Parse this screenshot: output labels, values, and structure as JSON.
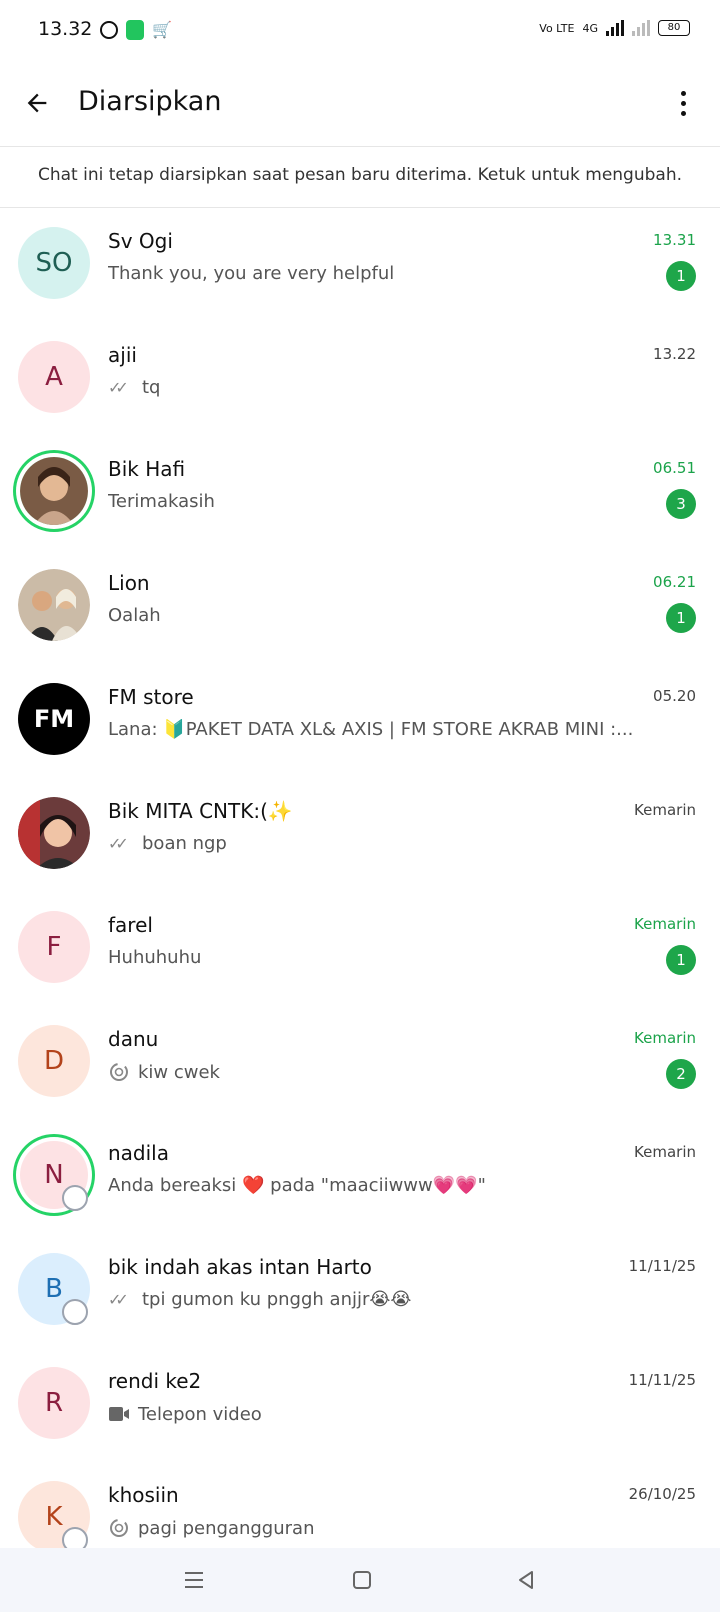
{
  "status_bar": {
    "time": "13.32",
    "network": "4G",
    "volte": "Vo LTE",
    "battery": "80"
  },
  "header": {
    "title": "Diarsipkan"
  },
  "notice": "Chat ini tetap diarsipkan saat pesan baru diterima. Ketuk untuk mengubah.",
  "colors": {
    "accent_green": "#1ea64a",
    "ring_green": "#25d366"
  },
  "chats": [
    {
      "name": "Sv Ogi",
      "initials": "SO",
      "avatar_bg": "#d5f2ef",
      "avatar_fg": "#1f5f54",
      "time": "13.31",
      "preview": "Thank you, you are very helpful",
      "unread": "1",
      "prefix_icon": ""
    },
    {
      "name": "ajii",
      "initials": "A",
      "avatar_bg": "#fde2e4",
      "avatar_fg": "#8b1e3f",
      "time": "13.22",
      "preview": "tq",
      "unread": "",
      "prefix_icon": "double-check-icon"
    },
    {
      "name": "Bik Hafi",
      "initials": "",
      "avatar_bg": "#c8a27a",
      "time": "06.51",
      "preview": "Terimakasih",
      "unread": "3",
      "prefix_icon": ""
    },
    {
      "name": "Lion",
      "initials": "",
      "avatar_bg": "#b9a48e",
      "time": "06.21",
      "preview": "Oalah",
      "unread": "1",
      "prefix_icon": ""
    },
    {
      "name": "FM store",
      "initials": "FM",
      "avatar_bg": "#000000",
      "avatar_fg": "#ffffff",
      "time": "05.20",
      "preview": "Lana: 🔰PAKET DATA XL& AXIS | FM STORE   AKRAB MINI :...",
      "unread": "",
      "prefix_icon": ""
    },
    {
      "name": "Bik MITA CNTK:(✨",
      "initials": "",
      "avatar_bg": "#6b3b3b",
      "time": "Kemarin",
      "preview": "boan ngp",
      "unread": "",
      "prefix_icon": "double-check-icon"
    },
    {
      "name": "farel",
      "initials": "F",
      "avatar_bg": "#fde2e4",
      "avatar_fg": "#8b1e3f",
      "time": "Kemarin",
      "preview": "Huhuhuhu",
      "unread": "1",
      "prefix_icon": ""
    },
    {
      "name": "danu",
      "initials": "D",
      "avatar_bg": "#fde6dc",
      "avatar_fg": "#b3431b",
      "time": "Kemarin",
      "preview": "kiw cwek",
      "unread": "2",
      "prefix_icon": "view-once-icon"
    },
    {
      "name": "nadila",
      "initials": "N",
      "avatar_bg": "#fde2e4",
      "avatar_fg": "#8b1e3f",
      "time": "Kemarin",
      "preview": "Anda bereaksi ❤️ pada \"maaciiwww💗💗\"",
      "unread": "",
      "prefix_icon": ""
    },
    {
      "name": "bik indah akas intan Harto",
      "initials": "B",
      "avatar_bg": "#dbeefd",
      "avatar_fg": "#1e6fb3",
      "time": "11/11/25",
      "preview": "tpi gumon ku pnggh anjjr😭😭",
      "unread": "",
      "prefix_icon": "double-check-icon"
    },
    {
      "name": "rendi ke2",
      "initials": "R",
      "avatar_bg": "#fde2e4",
      "avatar_fg": "#8b1e3f",
      "time": "11/11/25",
      "preview": "Telepon video",
      "unread": "",
      "prefix_icon": "video-call-icon"
    },
    {
      "name": "khosiin",
      "initials": "K",
      "avatar_bg": "#fde6dc",
      "avatar_fg": "#b3431b",
      "time": "26/10/25",
      "preview": "pagi pengangguran",
      "unread": "",
      "prefix_icon": "view-once-icon"
    }
  ]
}
